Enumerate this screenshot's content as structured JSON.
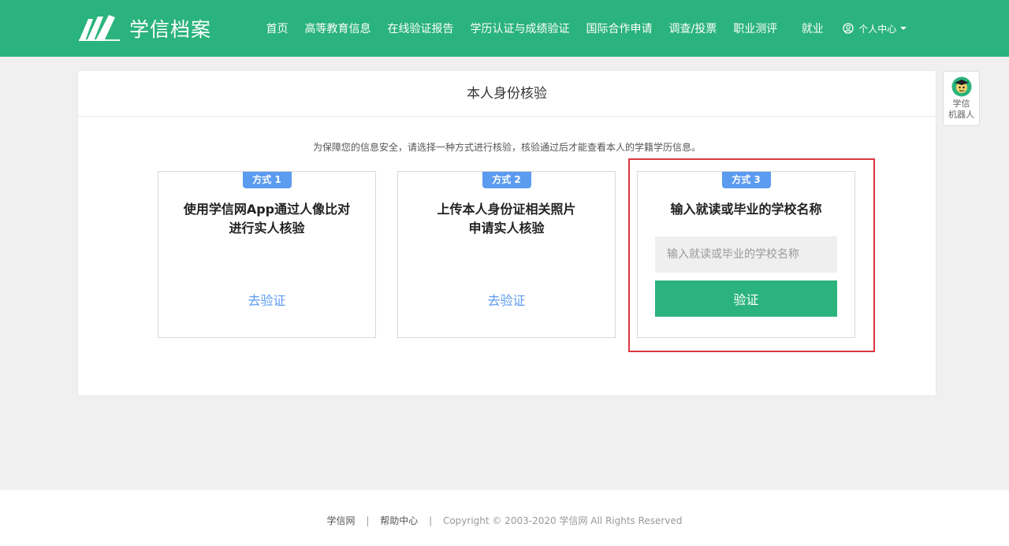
{
  "header": {
    "logo_text": "学信档案",
    "nav": [
      "首页",
      "高等教育信息",
      "在线验证报告",
      "学历认证与成绩验证",
      "国际合作申请",
      "调查/投票",
      "职业测评"
    ],
    "jiuye": "就业",
    "user_center": "个人中心",
    "colors": {
      "primary": "#2bb37d"
    }
  },
  "card": {
    "title": "本人身份核验",
    "notice": "为保障您的信息安全，请选择一种方式进行核验，核验通过后才能查看本人的学籍学历信息。",
    "methods": [
      {
        "badge": "方式 1",
        "title_line1": "使用学信网App通过人像比对",
        "title_line2": "进行实人核验",
        "link": "去验证"
      },
      {
        "badge": "方式 2",
        "title_line1": "上传本人身份证相关照片",
        "title_line2": "申请实人核验",
        "link": "去验证"
      },
      {
        "badge": "方式 3",
        "title_line1": "输入就读或毕业的学校名称",
        "input_value": "",
        "input_placeholder": "输入就读或毕业的学校名称",
        "button": "验证"
      }
    ],
    "colors": {
      "badge": "#5b9bf0",
      "highlight": "#d9383f"
    }
  },
  "robot": {
    "line1": "学信",
    "line2": "机器人"
  },
  "footer": {
    "link1": "学信网",
    "link2": "帮助中心",
    "copyright": "Copyright © 2003-2020 学信网 All Rights Reserved"
  }
}
